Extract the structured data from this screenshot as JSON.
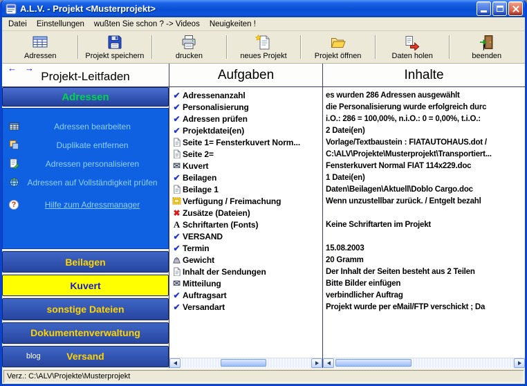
{
  "window": {
    "title": "A.L.V. - Projekt <Musterprojekt>",
    "statusbar": "Verz.: C:\\ALV\\Projekte\\Musterprojekt"
  },
  "menu": {
    "items": [
      {
        "label": "Datei"
      },
      {
        "label": "Einstellungen"
      },
      {
        "label": "wußten Sie schon ? -> Videos"
      },
      {
        "label": "Neuigkeiten !"
      }
    ]
  },
  "toolbar": {
    "buttons": [
      {
        "label": "Adressen",
        "icon": "addresses-icon"
      },
      {
        "label": "Projekt speichern",
        "icon": "save-icon"
      },
      {
        "label": "drucken",
        "icon": "print-icon"
      },
      {
        "label": "neues Projekt",
        "icon": "new-project-icon"
      },
      {
        "label": "Projekt öffnen",
        "icon": "open-project-icon"
      },
      {
        "label": "Daten holen",
        "icon": "fetch-data-icon"
      },
      {
        "label": "beenden",
        "icon": "exit-icon"
      }
    ]
  },
  "headers": {
    "left": "Projekt-Leitfaden",
    "middle": "Aufgaben",
    "right": "Inhalte",
    "back_arrow": "←",
    "forward_arrow": "→"
  },
  "sidebar": {
    "adressen_header": "Adressen",
    "adressen_items": [
      {
        "label": "Adressen bearbeiten",
        "icon": "table-icon"
      },
      {
        "label": "Duplikate entfernen",
        "icon": "duplicates-icon"
      },
      {
        "label": "Adressen personalisieren",
        "icon": "personalize-icon"
      },
      {
        "label": "Adressen auf Vollständigkeit prüfen",
        "icon": "completeness-icon"
      },
      {
        "label": "Hilfe zum Adressmanager",
        "icon": "help-icon",
        "link": true
      }
    ],
    "sections": [
      {
        "label": "Beilagen",
        "selected": false
      },
      {
        "label": "Kuvert",
        "selected": true
      },
      {
        "label": "sonstige Dateien",
        "selected": false
      },
      {
        "label": "Dokumentenverwaltung",
        "selected": false
      },
      {
        "label": "Versand",
        "selected": false,
        "badge": "blog"
      }
    ]
  },
  "tasks": {
    "rows": [
      {
        "icon": "check",
        "task": "Adressenanzahl",
        "content": "es wurden 286 Adressen ausgewählt"
      },
      {
        "icon": "check",
        "task": "Personalisierung",
        "content": "die Personalisierung wurde erfolgreich durc"
      },
      {
        "icon": "check",
        "task": "Adressen prüfen",
        "content": "i.O.: 286 = 100,00%, n.i.O.: 0 = 0,00%, t.i.O.:"
      },
      {
        "icon": "check",
        "task": "Projektdatei(en)",
        "content": "2 Datei(en)"
      },
      {
        "icon": "doc",
        "task": "Seite 1= Fensterkuvert Norm...",
        "content": "Vorlage/Textbaustein : FIATAUTOHAUS.dot /"
      },
      {
        "icon": "doc",
        "task": "Seite 2=",
        "content": "C:\\ALV\\Projekte\\Musterprojekt\\Transportiert..."
      },
      {
        "icon": "envelope",
        "task": "Kuvert",
        "content": "Fensterkuvert Normal FIAT 114x229.doc"
      },
      {
        "icon": "check",
        "task": "Beilagen",
        "content": "1 Datei(en)"
      },
      {
        "icon": "doc",
        "task": "Beilage 1",
        "content": "Daten\\Beilagen\\Aktuell\\Doblo Cargo.doc"
      },
      {
        "icon": "stamp",
        "task": "Verfügung / Freimachung",
        "content": "Wenn unzustellbar zurück. / Entgelt bezahl"
      },
      {
        "icon": "redx",
        "task": "Zusätze (Dateien)",
        "content": ""
      },
      {
        "icon": "font",
        "task": "Schriftarten (Fonts)",
        "content": "Keine Schriftarten im Projekt"
      },
      {
        "icon": "check",
        "task": "VERSAND",
        "content": ""
      },
      {
        "icon": "check",
        "task": "Termin",
        "content": "15.08.2003"
      },
      {
        "icon": "weight",
        "task": "Gewicht",
        "content": "20 Gramm"
      },
      {
        "icon": "doc",
        "task": "Inhalt der Sendungen",
        "content": "Der Inhalt der Seiten besteht aus 2 Teilen"
      },
      {
        "icon": "envelope",
        "task": "Mitteilung",
        "content": "Bitte Bilder einfügen"
      },
      {
        "icon": "check",
        "task": "Auftragsart",
        "content": "verbindlicher Auftrag"
      },
      {
        "icon": "check",
        "task": "Versandart",
        "content": "Projekt wurde per eMail/FTP verschickt ; Da"
      }
    ]
  }
}
